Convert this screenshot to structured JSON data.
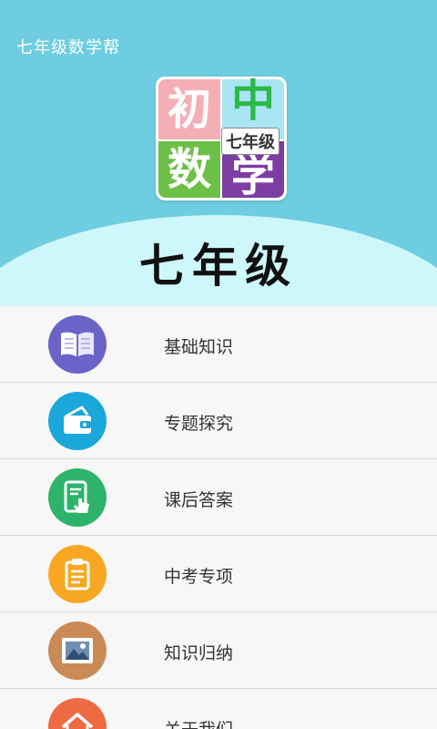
{
  "app": {
    "title": "七年级数学帮"
  },
  "banner": {
    "logo": {
      "chars": [
        "初",
        "中",
        "数",
        "学"
      ],
      "subtitle": "七年级"
    },
    "text": "七年级"
  },
  "colors": {
    "header_bg": "#6ecde0",
    "hill": "#cdf7fa",
    "logo_pink": "#f4aeb6",
    "logo_cyan": "#a9e5f3",
    "logo_green": "#6dc047",
    "logo_purple": "#7d3ea3"
  },
  "menu": {
    "items": [
      {
        "label": "基础知识",
        "icon": "book-icon",
        "color": "#6b63c8"
      },
      {
        "label": "专题探究",
        "icon": "wallet-icon",
        "color": "#1aa7d9"
      },
      {
        "label": "课后答案",
        "icon": "tablet-tap-icon",
        "color": "#2db36b"
      },
      {
        "label": "中考专项",
        "icon": "clipboard-icon",
        "color": "#f7a722"
      },
      {
        "label": "知识归纳",
        "icon": "picture-icon",
        "color": "#c98a55"
      },
      {
        "label": "关于我们",
        "icon": "home-icon",
        "color": "#ee6a43"
      }
    ]
  }
}
